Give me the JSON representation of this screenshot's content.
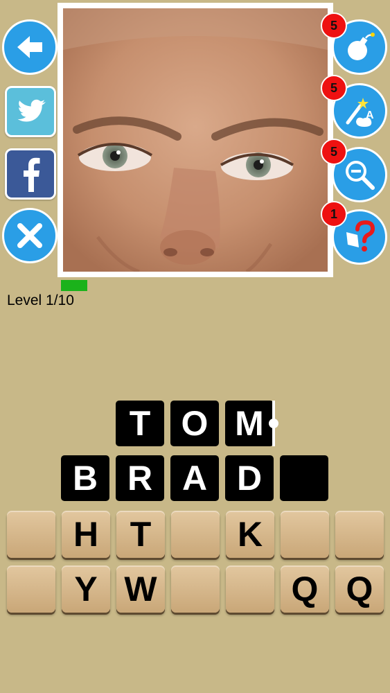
{
  "level": {
    "label": "Level 1/10",
    "progress": 0.1
  },
  "left_buttons": [
    {
      "name": "back-button",
      "icon": "back-arrow-icon"
    },
    {
      "name": "twitter-button",
      "icon": "twitter-icon"
    },
    {
      "name": "facebook-button",
      "icon": "facebook-icon"
    },
    {
      "name": "close-button",
      "icon": "close-icon"
    }
  ],
  "hints": [
    {
      "name": "bomb-hint-button",
      "icon": "bomb-icon",
      "count": "5"
    },
    {
      "name": "magic-letter-hint-button",
      "icon": "magic-wand-icon",
      "count": "5"
    },
    {
      "name": "zoom-out-hint-button",
      "icon": "zoom-out-icon",
      "count": "5"
    },
    {
      "name": "solve-hint-button",
      "icon": "question-icon",
      "count": "1"
    }
  ],
  "answer": {
    "row1": [
      "T",
      "O",
      "M"
    ],
    "row2": [
      "B",
      "R",
      "A",
      "D",
      ""
    ]
  },
  "keyboard": {
    "row1": [
      "",
      "H",
      "T",
      "",
      "K",
      "",
      ""
    ],
    "row2": [
      "",
      "Y",
      "W",
      "",
      "",
      "Q",
      "Q"
    ]
  },
  "colors": {
    "background": "#c8b888",
    "accent": "#2a9ee6",
    "badge": "#ee1111",
    "progress": "#1bb21b",
    "tile": "#000000"
  }
}
